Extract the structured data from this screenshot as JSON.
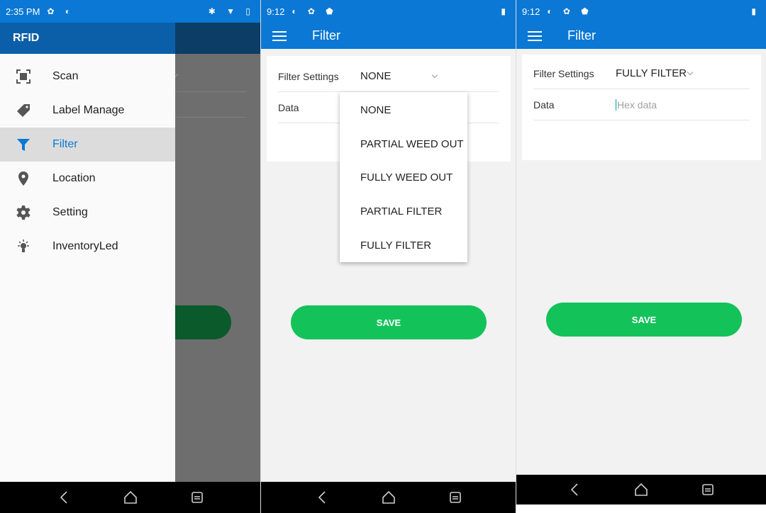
{
  "screen1": {
    "status_time": "2:35 PM",
    "drawer_title": "RFID",
    "menu": [
      {
        "label": "Scan",
        "icon": "scan-icon",
        "active": false
      },
      {
        "label": "Label Manage",
        "icon": "tag-icon",
        "active": false
      },
      {
        "label": "Filter",
        "icon": "filter-icon",
        "active": true
      },
      {
        "label": "Location",
        "icon": "location-pin-icon",
        "active": false
      },
      {
        "label": "Setting",
        "icon": "gear-icon",
        "active": false
      },
      {
        "label": "InventoryLed",
        "icon": "light-icon",
        "active": false
      }
    ]
  },
  "screen2": {
    "status_time": "9:12",
    "title": "Filter",
    "filter_settings_label": "Filter Settings",
    "filter_settings_value": "NONE",
    "data_label": "Data",
    "dropdown_options": [
      "NONE",
      "PARTIAL WEED OUT",
      "FULLY WEED OUT",
      "PARTIAL FILTER",
      "FULLY FILTER"
    ],
    "save_label": "SAVE"
  },
  "screen3": {
    "status_time": "9:12",
    "title": "Filter",
    "filter_settings_label": "Filter Settings",
    "filter_settings_value": "FULLY FILTER",
    "data_label": "Data",
    "data_placeholder": "Hex data",
    "save_label": "SAVE"
  },
  "colors": {
    "primary": "#0a78d4",
    "accent_green": "#14c25a",
    "drawer_header": "#0a5fa8",
    "nav_bar": "#000000"
  }
}
